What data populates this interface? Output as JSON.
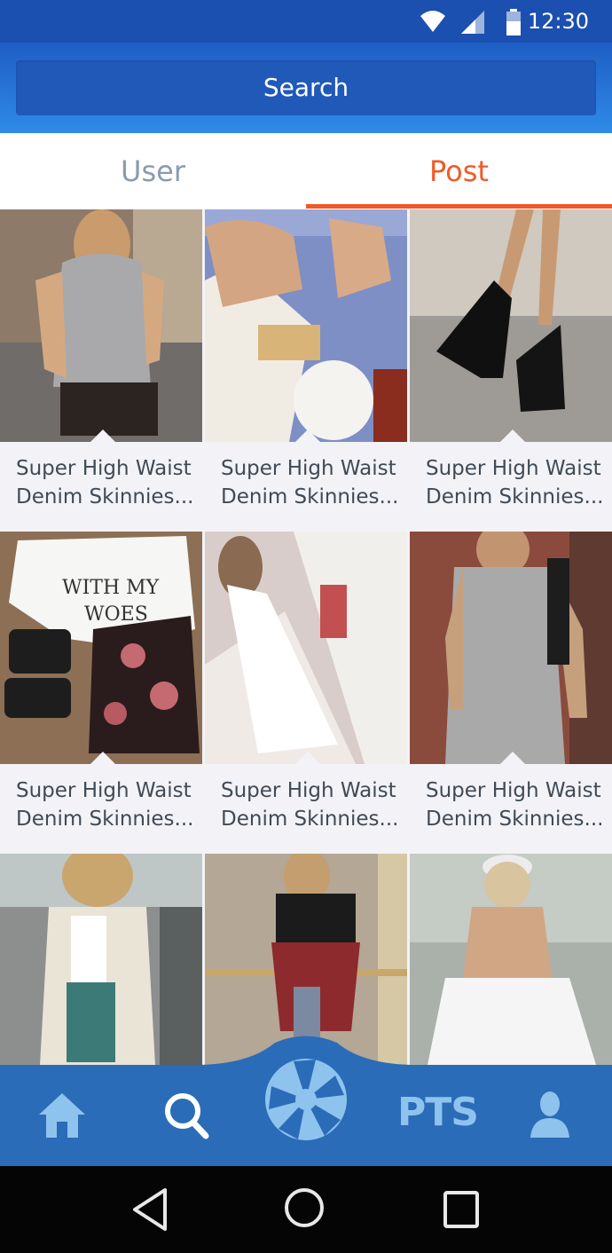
{
  "status_bar": {
    "time": "12:30",
    "icons": [
      "wifi-icon",
      "signal-icon",
      "battery-icon"
    ]
  },
  "search": {
    "label": "Search"
  },
  "tabs": [
    {
      "label": "User",
      "active": false
    },
    {
      "label": "Post",
      "active": true
    }
  ],
  "posts": [
    {
      "caption": "Super High Waist Denim Skinnies..."
    },
    {
      "caption": "Super High Waist Denim Skinnies..."
    },
    {
      "caption": "Super High Waist Denim Skinnies..."
    },
    {
      "caption": "Super High Waist Denim Skinnies..."
    },
    {
      "caption": "Super High Waist Denim Skinnies..."
    },
    {
      "caption": "Super High Waist Denim Skinnies..."
    },
    {
      "caption": ""
    },
    {
      "caption": ""
    },
    {
      "caption": ""
    }
  ],
  "bottom_nav": {
    "items": [
      "home-icon",
      "search-icon",
      "camera-shutter-icon",
      "pts",
      "profile-icon"
    ],
    "pts_label": "PTS"
  },
  "system_nav": [
    "back-icon",
    "home-circle-icon",
    "recents-icon"
  ],
  "colors": {
    "header_blue": "#1e5ec4",
    "accent_orange": "#f05a2a",
    "nav_blue": "#2b6cb8",
    "nav_icon": "#8ec3ee"
  }
}
